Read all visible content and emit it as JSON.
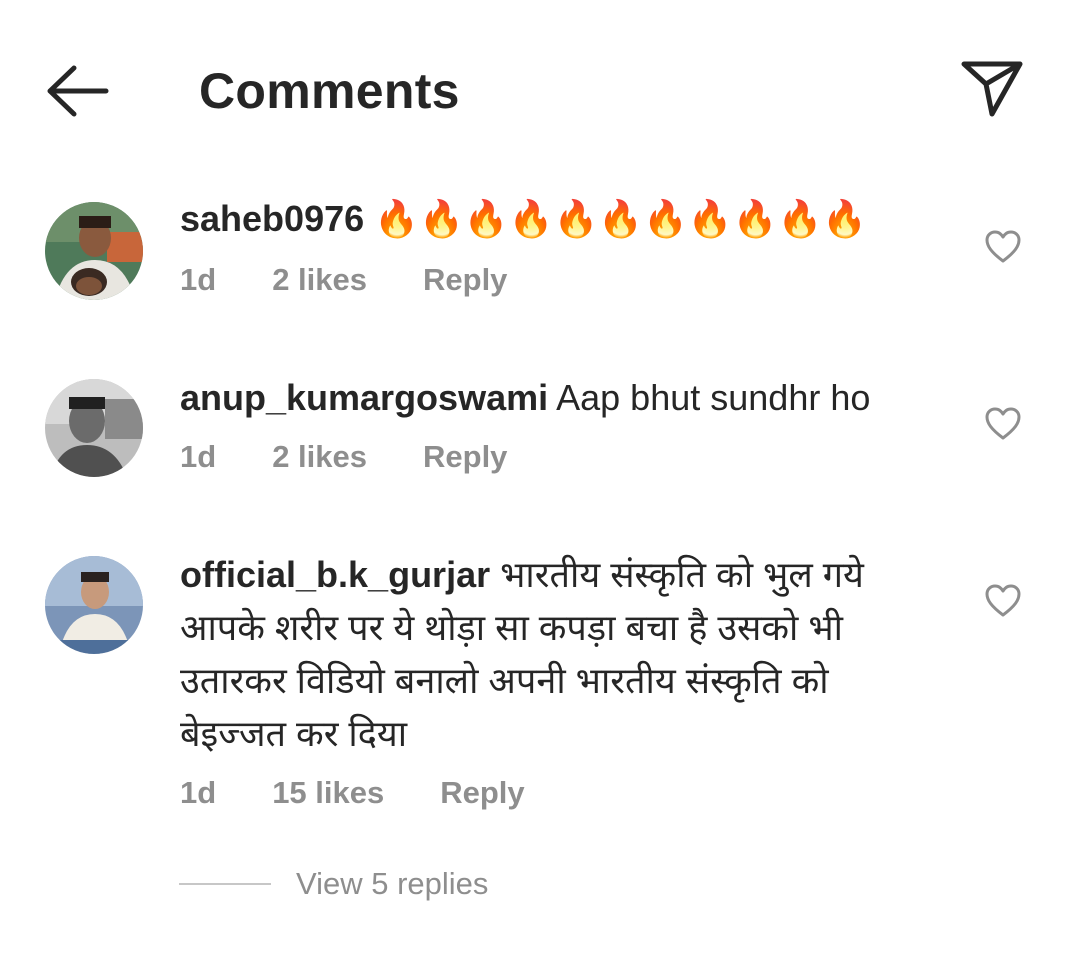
{
  "header": {
    "title": "Comments",
    "back_icon": "arrow-left-icon",
    "share_icon": "paper-plane-icon"
  },
  "comments": [
    {
      "username": "saheb0976",
      "text": "🔥🔥🔥🔥🔥🔥🔥🔥🔥🔥🔥",
      "time": "1d",
      "likes": "2 likes",
      "reply_label": "Reply"
    },
    {
      "username": "anup_kumargoswami",
      "text": "Aap bhut sundhr ho",
      "time": "1d",
      "likes": "2 likes",
      "reply_label": "Reply"
    },
    {
      "username": "official_b.k_gurjar",
      "text": "भारतीय संस्कृति को भुल गये आपके शरीर पर ये थोड़ा सा कपड़ा बचा है उसको भी उतारकर विडियो बनालो अपनी भारतीय संस्कृति को बेइज्जत कर दिया",
      "time": "1d",
      "likes": "15 likes",
      "reply_label": "Reply"
    }
  ],
  "view_replies": "View 5 replies",
  "colors": {
    "text_primary": "#262626",
    "text_secondary": "#8e8e8e",
    "divider": "#c7c7c7"
  }
}
